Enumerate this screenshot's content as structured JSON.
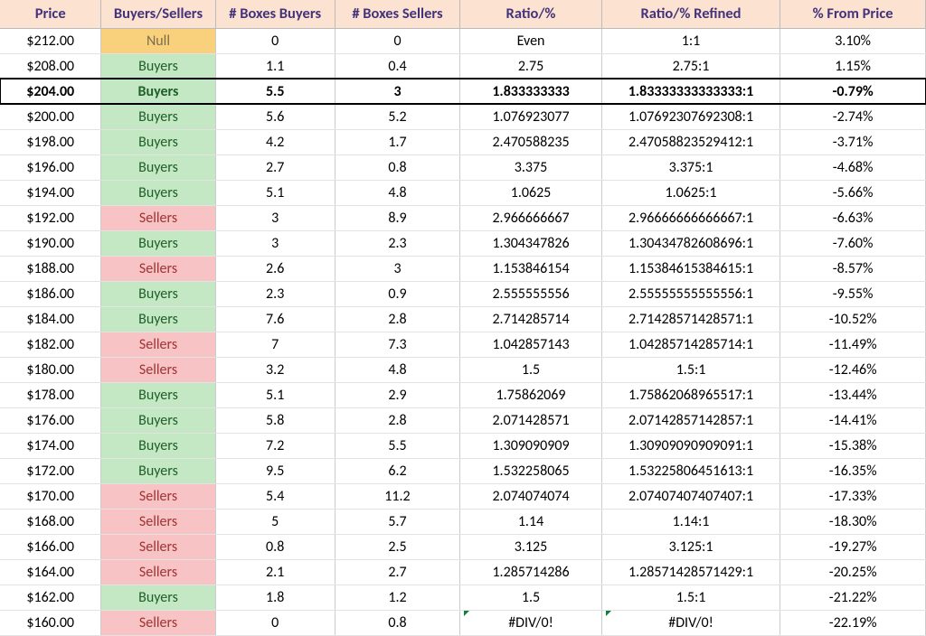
{
  "headers": {
    "price": "Price",
    "bs": "Buyers/Sellers",
    "boxes_buyers": "# Boxes Buyers",
    "boxes_sellers": "# Boxes Sellers",
    "ratio": "Ratio/%",
    "ratio_refined": "Ratio/% Refined",
    "from_price": "% From Price"
  },
  "bs_labels": {
    "buyers": "Buyers",
    "sellers": "Sellers",
    "null": "Null"
  },
  "rows": [
    {
      "price": "$212.00",
      "bs": "null",
      "boxes_buyers": "0",
      "boxes_sellers": "0",
      "ratio": "Even",
      "refined": "1:1",
      "from_price": "3.10%",
      "highlight": false,
      "err": false
    },
    {
      "price": "$208.00",
      "bs": "buyers",
      "boxes_buyers": "1.1",
      "boxes_sellers": "0.4",
      "ratio": "2.75",
      "refined": "2.75:1",
      "from_price": "1.15%",
      "highlight": false,
      "err": false
    },
    {
      "price": "$204.00",
      "bs": "buyers",
      "boxes_buyers": "5.5",
      "boxes_sellers": "3",
      "ratio": "1.833333333",
      "refined": "1.83333333333333:1",
      "from_price": "-0.79%",
      "highlight": true,
      "err": false
    },
    {
      "price": "$200.00",
      "bs": "buyers",
      "boxes_buyers": "5.6",
      "boxes_sellers": "5.2",
      "ratio": "1.076923077",
      "refined": "1.07692307692308:1",
      "from_price": "-2.74%",
      "highlight": false,
      "err": false
    },
    {
      "price": "$198.00",
      "bs": "buyers",
      "boxes_buyers": "4.2",
      "boxes_sellers": "1.7",
      "ratio": "2.470588235",
      "refined": "2.47058823529412:1",
      "from_price": "-3.71%",
      "highlight": false,
      "err": false
    },
    {
      "price": "$196.00",
      "bs": "buyers",
      "boxes_buyers": "2.7",
      "boxes_sellers": "0.8",
      "ratio": "3.375",
      "refined": "3.375:1",
      "from_price": "-4.68%",
      "highlight": false,
      "err": false
    },
    {
      "price": "$194.00",
      "bs": "buyers",
      "boxes_buyers": "5.1",
      "boxes_sellers": "4.8",
      "ratio": "1.0625",
      "refined": "1.0625:1",
      "from_price": "-5.66%",
      "highlight": false,
      "err": false
    },
    {
      "price": "$192.00",
      "bs": "sellers",
      "boxes_buyers": "3",
      "boxes_sellers": "8.9",
      "ratio": "2.966666667",
      "refined": "2.96666666666667:1",
      "from_price": "-6.63%",
      "highlight": false,
      "err": false
    },
    {
      "price": "$190.00",
      "bs": "buyers",
      "boxes_buyers": "3",
      "boxes_sellers": "2.3",
      "ratio": "1.304347826",
      "refined": "1.30434782608696:1",
      "from_price": "-7.60%",
      "highlight": false,
      "err": false
    },
    {
      "price": "$188.00",
      "bs": "sellers",
      "boxes_buyers": "2.6",
      "boxes_sellers": "3",
      "ratio": "1.153846154",
      "refined": "1.15384615384615:1",
      "from_price": "-8.57%",
      "highlight": false,
      "err": false
    },
    {
      "price": "$186.00",
      "bs": "buyers",
      "boxes_buyers": "2.3",
      "boxes_sellers": "0.9",
      "ratio": "2.555555556",
      "refined": "2.55555555555556:1",
      "from_price": "-9.55%",
      "highlight": false,
      "err": false
    },
    {
      "price": "$184.00",
      "bs": "buyers",
      "boxes_buyers": "7.6",
      "boxes_sellers": "2.8",
      "ratio": "2.714285714",
      "refined": "2.71428571428571:1",
      "from_price": "-10.52%",
      "highlight": false,
      "err": false
    },
    {
      "price": "$182.00",
      "bs": "sellers",
      "boxes_buyers": "7",
      "boxes_sellers": "7.3",
      "ratio": "1.042857143",
      "refined": "1.04285714285714:1",
      "from_price": "-11.49%",
      "highlight": false,
      "err": false
    },
    {
      "price": "$180.00",
      "bs": "sellers",
      "boxes_buyers": "3.2",
      "boxes_sellers": "4.8",
      "ratio": "1.5",
      "refined": "1.5:1",
      "from_price": "-12.46%",
      "highlight": false,
      "err": false
    },
    {
      "price": "$178.00",
      "bs": "buyers",
      "boxes_buyers": "5.1",
      "boxes_sellers": "2.9",
      "ratio": "1.75862069",
      "refined": "1.75862068965517:1",
      "from_price": "-13.44%",
      "highlight": false,
      "err": false
    },
    {
      "price": "$176.00",
      "bs": "buyers",
      "boxes_buyers": "5.8",
      "boxes_sellers": "2.8",
      "ratio": "2.071428571",
      "refined": "2.07142857142857:1",
      "from_price": "-14.41%",
      "highlight": false,
      "err": false
    },
    {
      "price": "$174.00",
      "bs": "buyers",
      "boxes_buyers": "7.2",
      "boxes_sellers": "5.5",
      "ratio": "1.309090909",
      "refined": "1.30909090909091:1",
      "from_price": "-15.38%",
      "highlight": false,
      "err": false
    },
    {
      "price": "$172.00",
      "bs": "buyers",
      "boxes_buyers": "9.5",
      "boxes_sellers": "6.2",
      "ratio": "1.532258065",
      "refined": "1.53225806451613:1",
      "from_price": "-16.35%",
      "highlight": false,
      "err": false
    },
    {
      "price": "$170.00",
      "bs": "sellers",
      "boxes_buyers": "5.4",
      "boxes_sellers": "11.2",
      "ratio": "2.074074074",
      "refined": "2.07407407407407:1",
      "from_price": "-17.33%",
      "highlight": false,
      "err": false
    },
    {
      "price": "$168.00",
      "bs": "sellers",
      "boxes_buyers": "5",
      "boxes_sellers": "5.7",
      "ratio": "1.14",
      "refined": "1.14:1",
      "from_price": "-18.30%",
      "highlight": false,
      "err": false
    },
    {
      "price": "$166.00",
      "bs": "sellers",
      "boxes_buyers": "0.8",
      "boxes_sellers": "2.5",
      "ratio": "3.125",
      "refined": "3.125:1",
      "from_price": "-19.27%",
      "highlight": false,
      "err": false
    },
    {
      "price": "$164.00",
      "bs": "sellers",
      "boxes_buyers": "2.1",
      "boxes_sellers": "2.7",
      "ratio": "1.285714286",
      "refined": "1.28571428571429:1",
      "from_price": "-20.25%",
      "highlight": false,
      "err": false
    },
    {
      "price": "$162.00",
      "bs": "buyers",
      "boxes_buyers": "1.8",
      "boxes_sellers": "1.2",
      "ratio": "1.5",
      "refined": "1.5:1",
      "from_price": "-21.22%",
      "highlight": false,
      "err": false
    },
    {
      "price": "$160.00",
      "bs": "sellers",
      "boxes_buyers": "0",
      "boxes_sellers": "0.8",
      "ratio": "#DIV/0!",
      "refined": "#DIV/0!",
      "from_price": "-22.19%",
      "highlight": false,
      "err": true
    }
  ],
  "chart_data": {
    "type": "table",
    "title": "Buyers/Sellers box counts by price level",
    "columns": [
      "Price",
      "Buyers/Sellers",
      "# Boxes Buyers",
      "# Boxes Sellers",
      "Ratio/%",
      "Ratio/% Refined",
      "% From Price"
    ]
  }
}
